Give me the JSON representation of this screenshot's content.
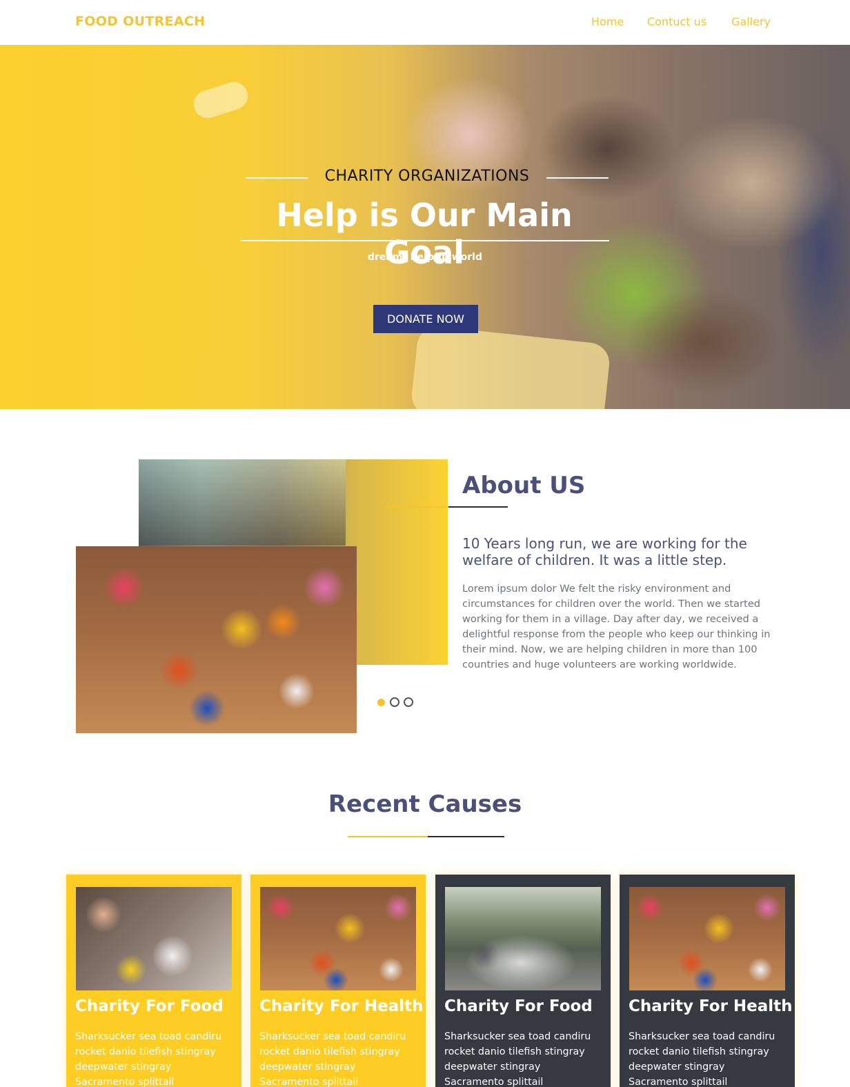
{
  "nav": {
    "brand": "FOOD OUTREACH",
    "links": [
      "Home",
      "Contuct us",
      "Gallery"
    ]
  },
  "hero": {
    "kicker": "CHARITY ORGANIZATIONS",
    "title": "Help is Our Main Goal",
    "subtitle": "dream! helpful world",
    "cta": "DONATE NOW"
  },
  "about": {
    "title": "About US",
    "lead": "10 Years long run, we are working for the welfare of children. It was a little step.",
    "body": "Lorem ipsum dolor We felt the risky environment and circumstances for children over the world. Then we started working for them in a village. Day after day, we received a delightful response from the people who keep our thinking in their mind. Now, we are helping children in more than 100 countries and huge volunteers are working worldwide.",
    "slider_total": 3,
    "slider_active": 1
  },
  "causes": {
    "title": "Recent Causes",
    "cards": [
      {
        "title": "Charity For Food",
        "text": "Sharksucker sea toad candiru rocket danio tilefish stingray deepwater stingray Sacramento splittail",
        "theme": "yellow"
      },
      {
        "title": "Charity For Health",
        "text": "Sharksucker sea toad candiru rocket danio tilefish stingray deepwater stingray Sacramento splittail",
        "theme": "yellow"
      },
      {
        "title": "Charity For Food",
        "text": "Sharksucker sea toad candiru rocket danio tilefish stingray deepwater stingray Sacramento splittail",
        "theme": "dark"
      },
      {
        "title": "Charity For Health",
        "text": "Sharksucker sea toad candiru rocket danio tilefish stingray deepwater stingray Sacramento splittail",
        "theme": "dark"
      }
    ]
  },
  "colors": {
    "brand_yellow": "#f5c528",
    "navy": "#2e3878",
    "heading": "#4a5078",
    "card_dark": "#343a40"
  }
}
